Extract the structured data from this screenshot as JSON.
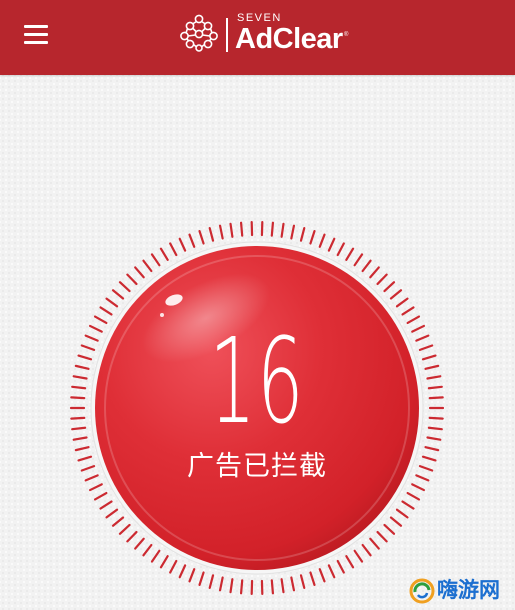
{
  "header": {
    "menu_icon": "hamburger-menu-icon",
    "brand_kicker": "SEVEN",
    "brand_name": "AdClear",
    "brand_registered": "®",
    "logo_icon": "network-nodes-icon",
    "background_color": "#b7262d"
  },
  "counter": {
    "value": "16",
    "label": "广告已拦截",
    "dial_color": "#d9262e",
    "tick_color": "#cc2a31"
  },
  "watermark": {
    "text": "嗨游网",
    "icon": "swirl-logo-icon"
  }
}
